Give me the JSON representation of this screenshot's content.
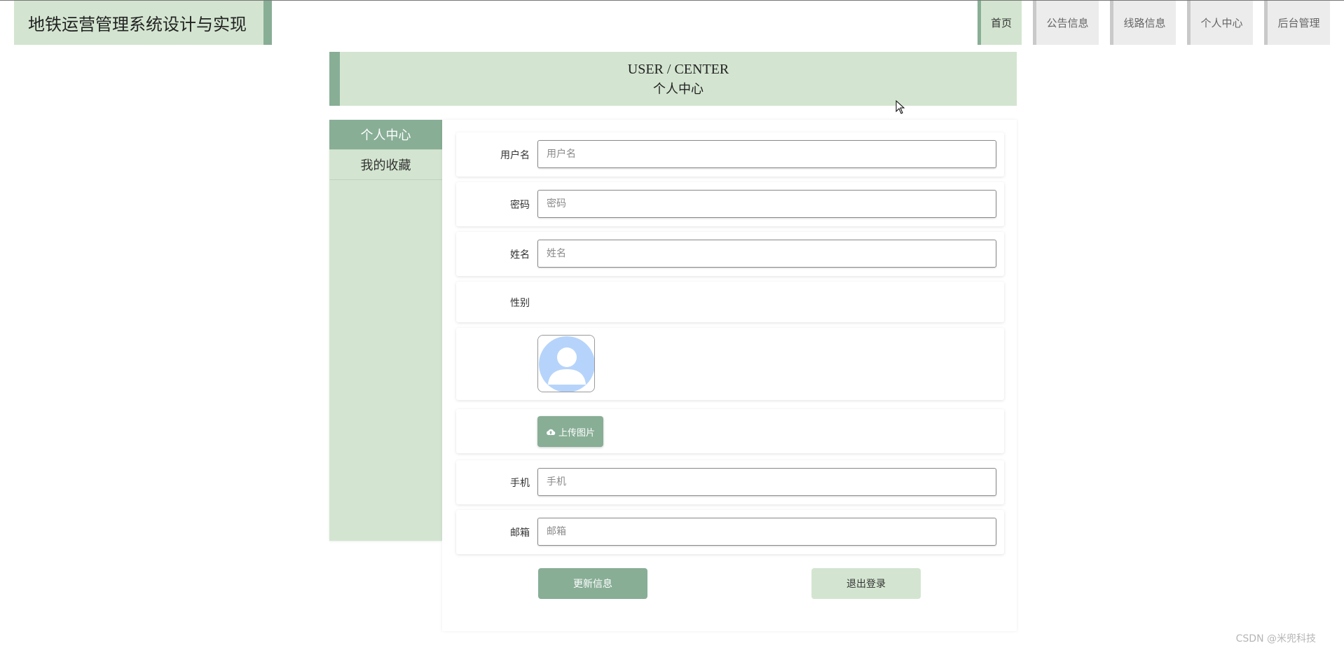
{
  "app": {
    "title": "地铁运营管理系统设计与实现"
  },
  "nav": {
    "items": [
      "首页",
      "公告信息",
      "线路信息",
      "个人中心",
      "后台管理"
    ],
    "active_index": 0
  },
  "banner": {
    "en": "USER / CENTER",
    "cn": "个人中心"
  },
  "sidebar": {
    "items": [
      "个人中心",
      "我的收藏"
    ],
    "active_index": 0
  },
  "form": {
    "username": {
      "label": "用户名",
      "placeholder": "用户名",
      "value": ""
    },
    "password": {
      "label": "密码",
      "placeholder": "密码",
      "value": ""
    },
    "name": {
      "label": "姓名",
      "placeholder": "姓名",
      "value": ""
    },
    "gender": {
      "label": "性别"
    },
    "upload_label": "上传图片",
    "phone": {
      "label": "手机",
      "placeholder": "手机",
      "value": ""
    },
    "email": {
      "label": "邮箱",
      "placeholder": "邮箱",
      "value": ""
    }
  },
  "actions": {
    "update": "更新信息",
    "logout": "退出登录"
  },
  "watermark": "CSDN @米兜科技",
  "colors": {
    "accent": "#88ae96",
    "accent_light": "#d3e5d0",
    "avatar_blue": "#b6d4fb"
  }
}
